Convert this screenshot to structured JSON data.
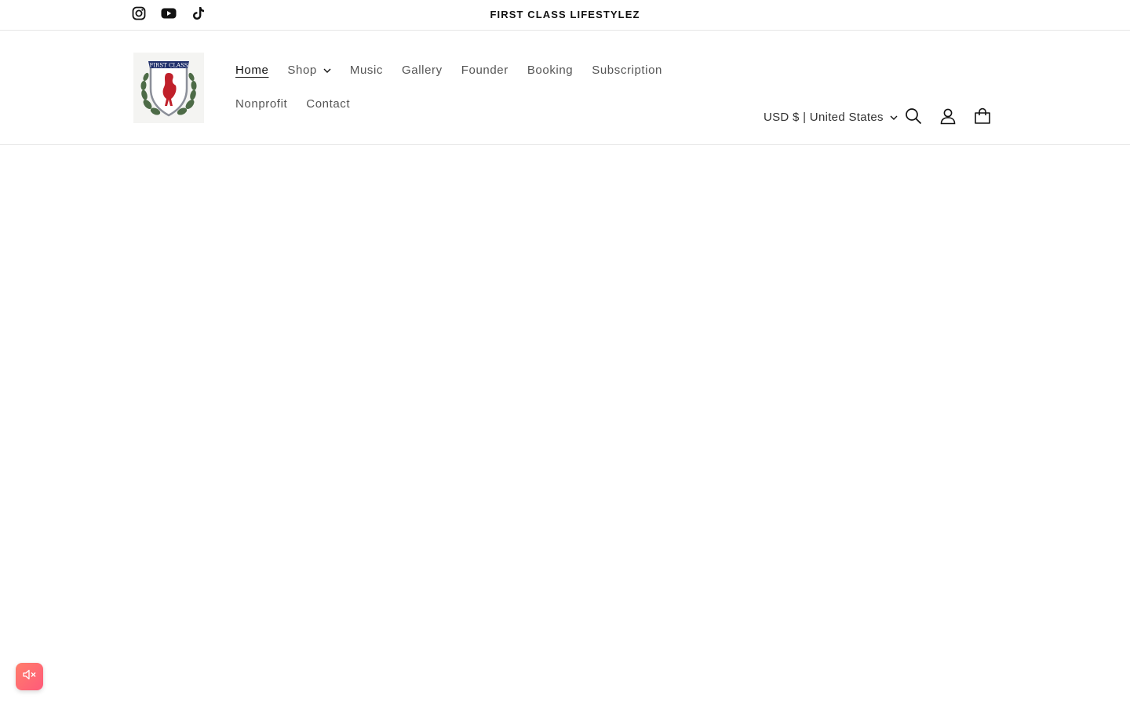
{
  "announcement": {
    "text": "FIRST CLASS LIFESTYLEZ"
  },
  "social": [
    {
      "icon": "instagram-icon"
    },
    {
      "icon": "youtube-icon"
    },
    {
      "icon": "tiktok-icon"
    }
  ],
  "logo": {
    "banner_text": "FIRST CLASS"
  },
  "nav": {
    "home": "Home",
    "shop": "Shop",
    "music": "Music",
    "gallery": "Gallery",
    "founder": "Founder",
    "booking": "Booking",
    "subscription": "Subscription",
    "nonprofit": "Nonprofit",
    "contact": "Contact"
  },
  "localization": {
    "label": "USD $ | United States"
  },
  "header_icons": [
    "search-icon",
    "account-icon",
    "cart-icon"
  ],
  "colors": {
    "text": "#121212",
    "nav_text": "#555555",
    "border": "#e6e6e6",
    "sound_button": "#ff6b73"
  }
}
